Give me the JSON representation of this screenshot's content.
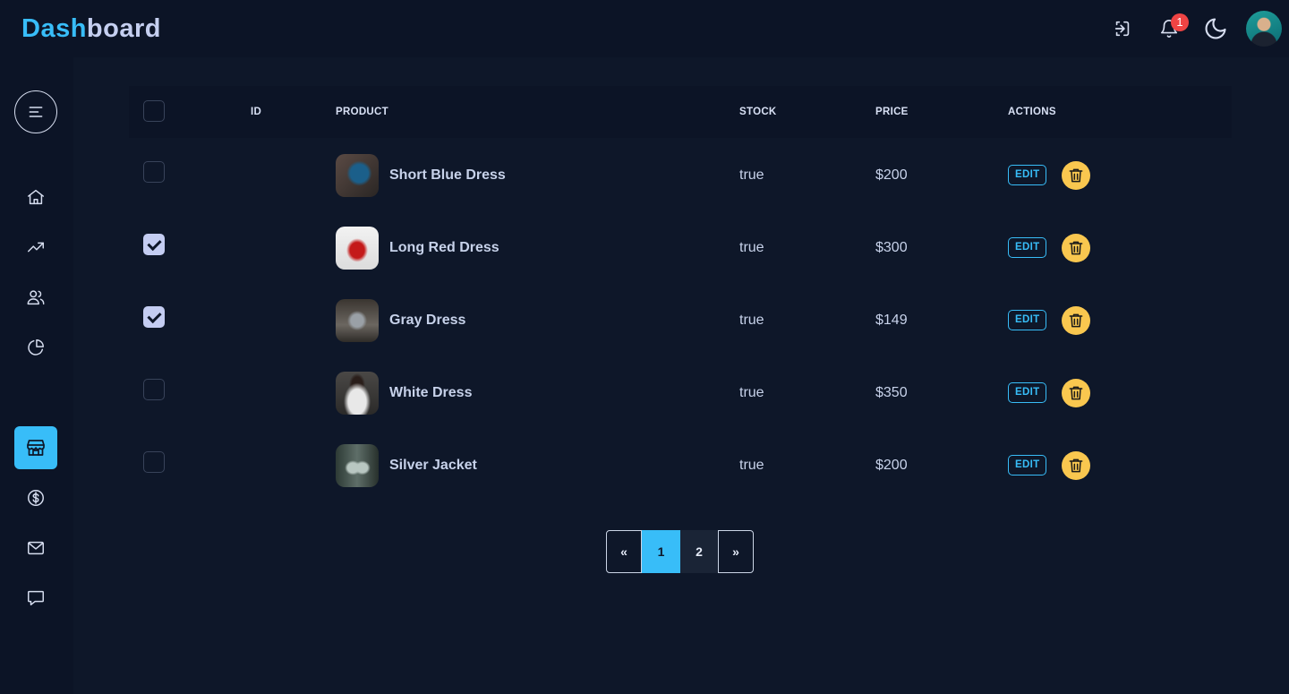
{
  "header": {
    "logo_part1": "Dash",
    "logo_part2": "board",
    "notification_count": "1",
    "icons": [
      "logout-icon",
      "bell-icon",
      "moon-icon"
    ]
  },
  "sidebar": {
    "items": [
      {
        "icon": "home-icon",
        "active": false
      },
      {
        "icon": "trending-up-icon",
        "active": false
      },
      {
        "icon": "users-icon",
        "active": false
      },
      {
        "icon": "pie-chart-icon",
        "active": false
      },
      {
        "icon": "store-icon",
        "active": true
      },
      {
        "icon": "dollar-icon",
        "active": false
      },
      {
        "icon": "mail-icon",
        "active": false
      },
      {
        "icon": "chat-icon",
        "active": false
      }
    ]
  },
  "table": {
    "headers": {
      "id": "ID",
      "product": "PRODUCT",
      "stock": "STOCK",
      "price": "PRICE",
      "actions": "ACTIONS"
    },
    "header_checked": false,
    "rows": [
      {
        "checked": false,
        "id": "",
        "name": "Short Blue Dress",
        "stock": "true",
        "price": "$200",
        "edit": "EDIT"
      },
      {
        "checked": true,
        "id": "",
        "name": "Long Red Dress",
        "stock": "true",
        "price": "$300",
        "edit": "EDIT"
      },
      {
        "checked": true,
        "id": "",
        "name": "Gray Dress",
        "stock": "true",
        "price": "$149",
        "edit": "EDIT"
      },
      {
        "checked": false,
        "id": "",
        "name": "White Dress",
        "stock": "true",
        "price": "$350",
        "edit": "EDIT"
      },
      {
        "checked": false,
        "id": "",
        "name": "Silver Jacket",
        "stock": "true",
        "price": "$200",
        "edit": "EDIT"
      }
    ]
  },
  "pagination": {
    "prev": "«",
    "pages": [
      "1",
      "2"
    ],
    "current": "1",
    "next": "»"
  },
  "colors": {
    "background": "#0e1729",
    "panel": "#0c1426",
    "accent": "#38bdf8",
    "delete": "#f9c74f",
    "badge": "#ef4444"
  }
}
